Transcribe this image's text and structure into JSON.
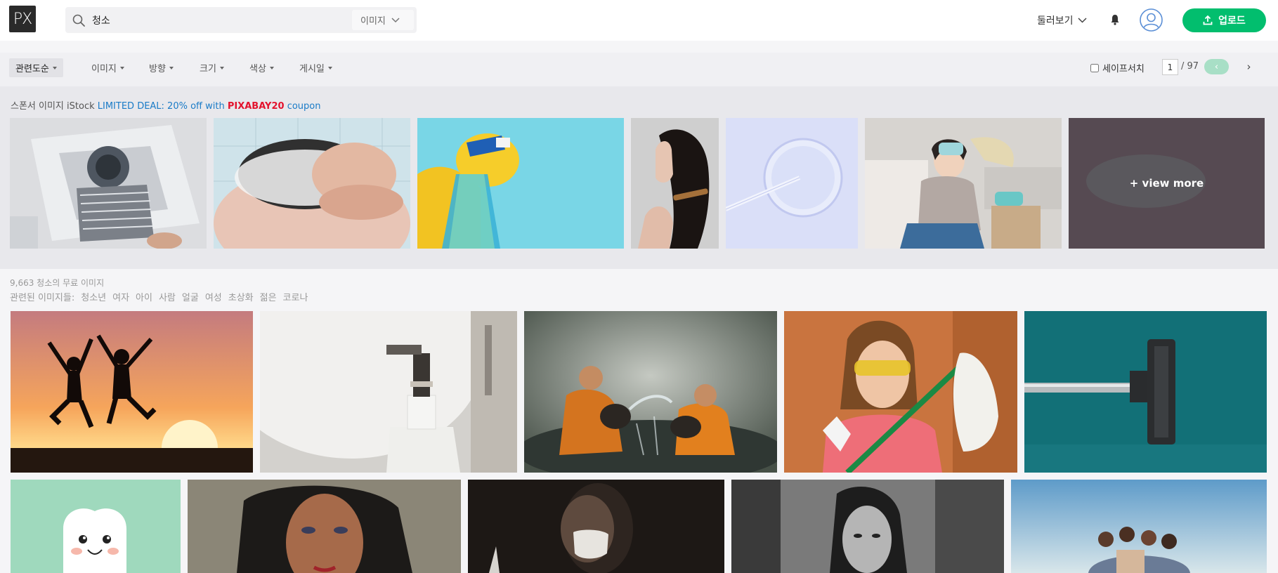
{
  "header": {
    "logo_text": "PX",
    "search_value": "청소",
    "search_type": "이미지",
    "explore_label": "둘러보기",
    "upload_label": "업로드"
  },
  "filters": {
    "items": [
      "관련도순",
      "이미지",
      "방향",
      "크기",
      "색상",
      "게시일"
    ],
    "safe_search_label": "세이프서치",
    "page_current": "1",
    "page_total": "/ 97",
    "prev_symbol": "‹",
    "next_symbol": "›"
  },
  "sponsored": {
    "prefix": "스폰서 이미지 iStock",
    "deal": "LIMITED DEAL: 20% off with",
    "code": "PIXABAY20",
    "suffix": "coupon",
    "view_more": "+ view more",
    "tiles": [
      {
        "name": "air-conditioner-photo"
      },
      {
        "name": "hair-washing-photo"
      },
      {
        "name": "spray-bottle-photo"
      },
      {
        "name": "hair-profile-photo"
      },
      {
        "name": "petri-dish-photo"
      },
      {
        "name": "tired-woman-cleaning-photo"
      }
    ]
  },
  "results": {
    "count_text": "9,663 청소의 무료 이미지",
    "related_label": "관련된 이미지들:",
    "related_terms": [
      "청소년",
      "여자",
      "아이",
      "사람",
      "얼굴",
      "여성",
      "초상화",
      "젊은",
      "코로나"
    ]
  },
  "colors": {
    "brand_green": "#02be6e",
    "sponsor_blue": "#1a7bc7",
    "coupon_red": "#e3132e"
  }
}
